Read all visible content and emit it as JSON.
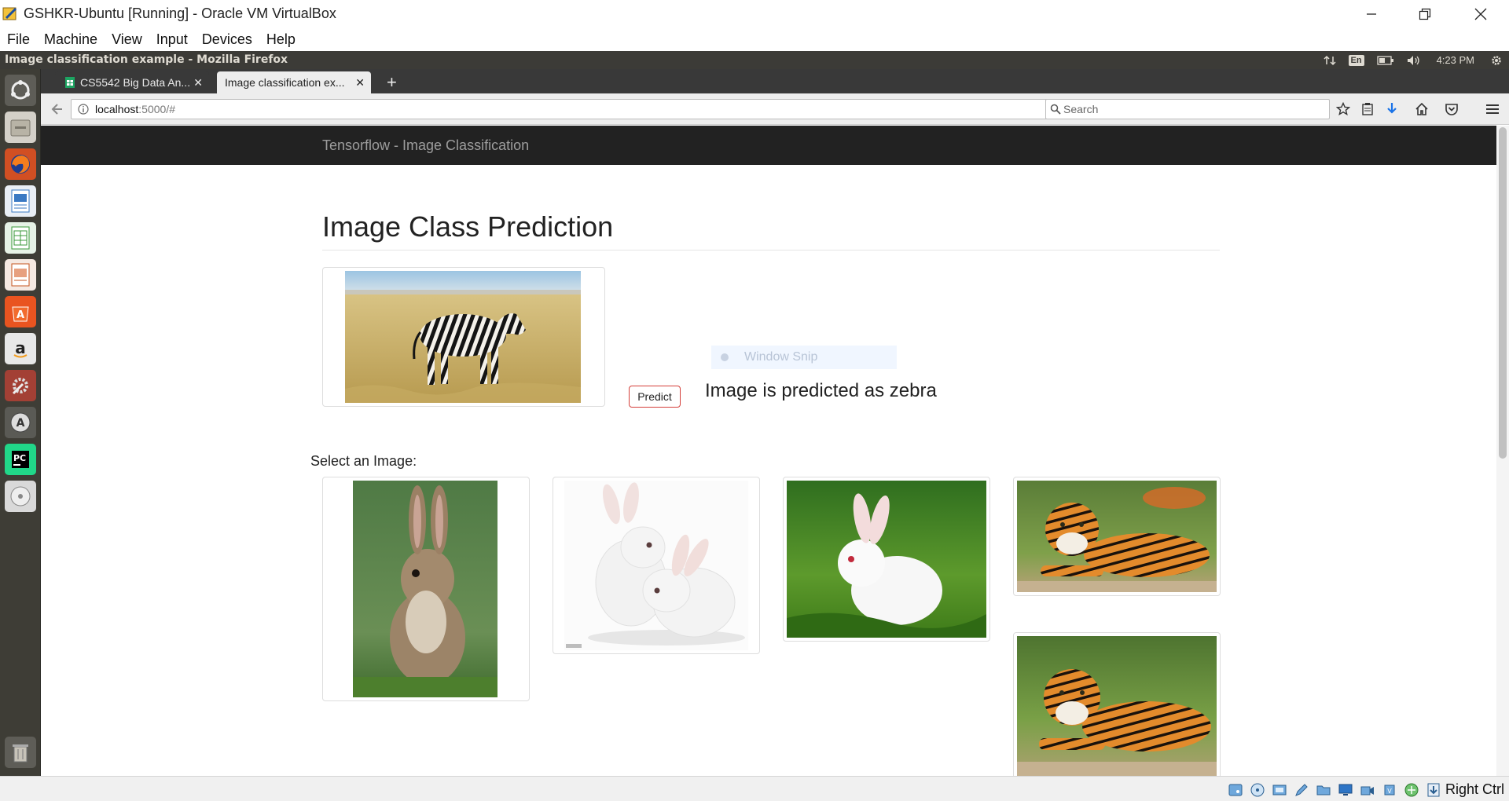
{
  "host_window": {
    "title": "GSHKR-Ubuntu [Running] - Oracle VM VirtualBox",
    "menu": [
      "File",
      "Machine",
      "View",
      "Input",
      "Devices",
      "Help"
    ],
    "host_key_label": "Right Ctrl"
  },
  "ubuntu_panel": {
    "window_title": "Image classification example - Mozilla Firefox",
    "keyboard_layout": "En",
    "clock": "4:23 PM"
  },
  "launcher": {
    "icons": [
      "ubuntu-dash-icon",
      "files-icon",
      "firefox-icon",
      "writer-icon",
      "calc-icon",
      "impress-icon",
      "software-center-icon",
      "amazon-icon",
      "system-settings-icon",
      "software-updater-icon",
      "pycharm-icon",
      "dvd-icon",
      "trash-icon"
    ]
  },
  "browser": {
    "tabs": [
      {
        "label": "CS5542 Big Data An...",
        "active": false
      },
      {
        "label": "Image classification ex...",
        "active": true
      }
    ],
    "url_host": "localhost",
    "url_rest": ":5000/#",
    "search_placeholder": "Search"
  },
  "page": {
    "brand": "Tensorflow - Image Classification",
    "title": "Image Class Prediction",
    "predict_label": "Predict",
    "result": "Image is predicted as zebra",
    "select_label": "Select an Image:",
    "overlay_label": "Window Snip",
    "selected_image": "zebra",
    "gallery": [
      "brown rabbit",
      "two white rabbits",
      "white rabbit on grass",
      "tiger lying",
      "tiger lying"
    ]
  },
  "colors": {
    "app_navbar": "#222222",
    "brand_text": "#9d9d9d",
    "predict_border": "#d43f3a",
    "ubuntu_panel": "#3c3b37",
    "launcher": "#3e3d36"
  }
}
